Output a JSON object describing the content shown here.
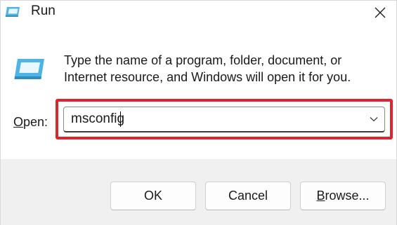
{
  "window": {
    "title": "Run",
    "close_icon": "close-icon"
  },
  "main": {
    "description_line1": "Type the name of a program, folder, document, or",
    "description_line2": "Internet resource, and Windows will open it for you.",
    "open_label_mnemonic": "O",
    "open_label_rest": "pen:",
    "open_value": "msconfig",
    "highlight_color": "#d9262f"
  },
  "buttons": {
    "ok": "OK",
    "cancel": "Cancel",
    "browse_mnemonic": "B",
    "browse_rest": "rowse..."
  }
}
